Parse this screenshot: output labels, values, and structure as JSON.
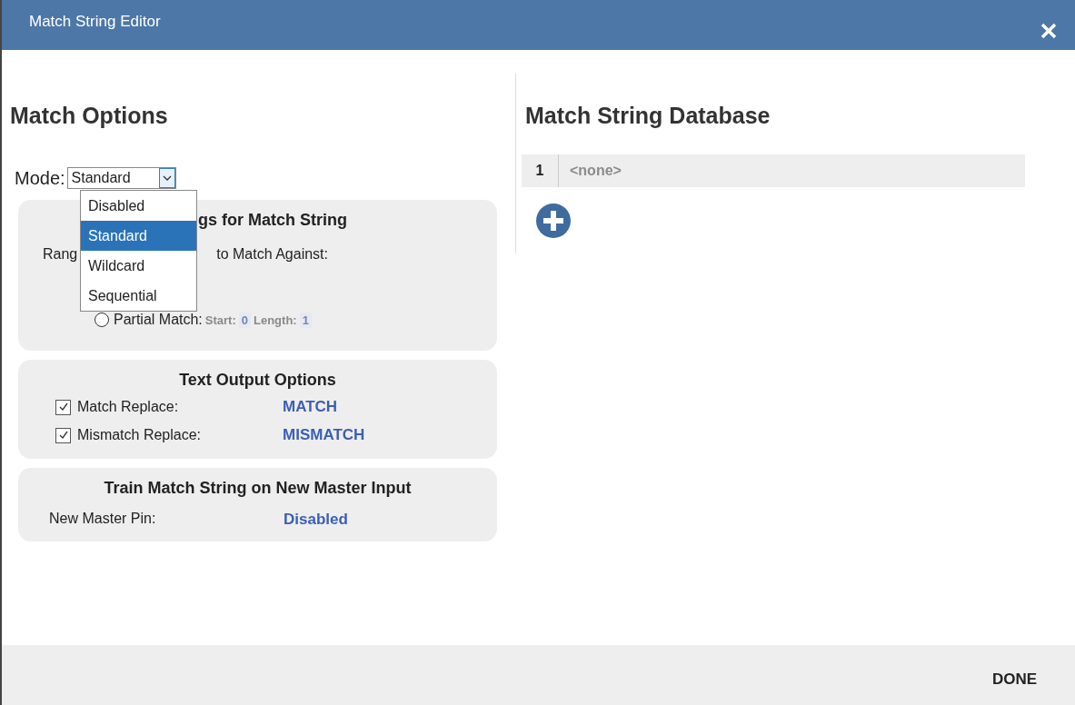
{
  "window": {
    "title": "Match String Editor"
  },
  "match_options": {
    "title": "Match Options",
    "mode": {
      "label": "Mode:",
      "value": "Standard",
      "options": [
        {
          "label": "Disabled",
          "selected": false
        },
        {
          "label": "Standard",
          "selected": true
        },
        {
          "label": "Wildcard",
          "selected": false
        },
        {
          "label": "Sequential",
          "selected": false
        }
      ]
    },
    "match_settings": {
      "title_visible": "gs for Match String",
      "range_label_parts": [
        "Rang",
        "to Match Against:"
      ],
      "partial_match": {
        "label": "Partial Match:",
        "selected": false,
        "disabled": true,
        "start_label": "Start:",
        "start": "0",
        "length_label": "Length:",
        "length": "1"
      }
    },
    "text_output": {
      "title": "Text Output Options",
      "rows": [
        {
          "label": "Match Replace:",
          "checked": true,
          "value": "MATCH"
        },
        {
          "label": "Mismatch Replace:",
          "checked": true,
          "value": "MISMATCH"
        }
      ]
    },
    "train": {
      "title": "Train Match String on New Master Input",
      "rows": [
        {
          "label": "New Master Pin:",
          "value": "Disabled"
        }
      ]
    }
  },
  "database": {
    "title": "Match String Database",
    "rows": [
      {
        "index": "1",
        "value": "<none>"
      }
    ]
  },
  "footer": {
    "done": "DONE"
  }
}
